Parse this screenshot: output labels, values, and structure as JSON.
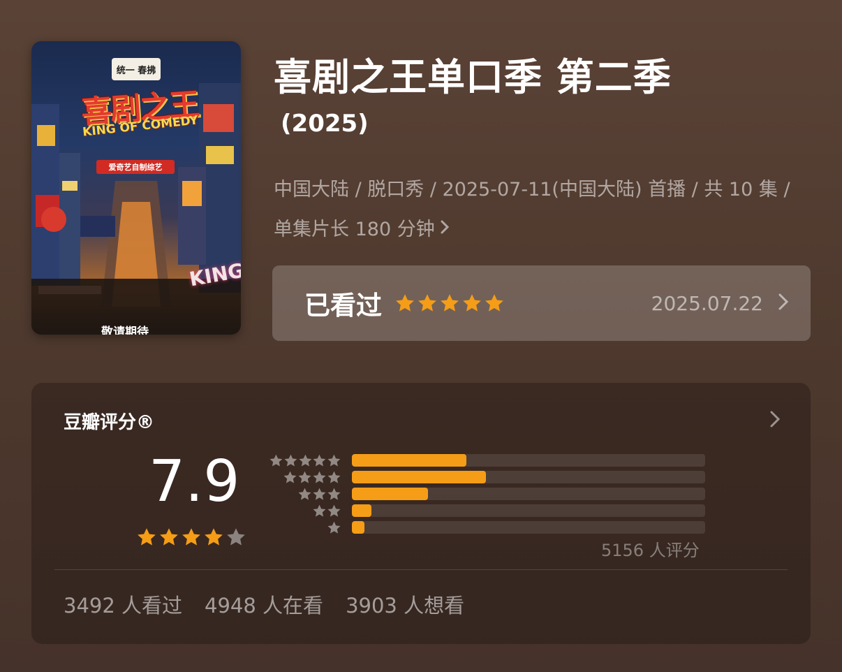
{
  "poster": {
    "badge": "统一 春拂",
    "title_cn": "喜剧之王",
    "title_en": "KING OF COMEDY",
    "subtitle": "爱奇艺自制综艺",
    "bottom_text": "敬请期待",
    "sign": "KING"
  },
  "header": {
    "title": "喜剧之王单口季 第二季",
    "year": "(2025)",
    "meta": "中国大陆 / 脱口秀 / 2025-07-11(中国大陆) 首播 / 共 10 集 / 单集片长 180 分钟"
  },
  "watched": {
    "label": "已看过",
    "stars": 5,
    "date": "2025.07.22"
  },
  "rating": {
    "title": "豆瓣评分®",
    "score": "7.9",
    "stars": 4,
    "distribution": [
      {
        "stars": 5,
        "fraction": 0.325
      },
      {
        "stars": 4,
        "fraction": 0.38
      },
      {
        "stars": 3,
        "fraction": 0.215
      },
      {
        "stars": 2,
        "fraction": 0.055
      },
      {
        "stars": 1,
        "fraction": 0.035
      }
    ],
    "count_text": "5156 人评分"
  },
  "stats": {
    "watched": "3492 人看过",
    "watching": "4948 人在看",
    "wish": "3903 人想看"
  },
  "colors": {
    "accent": "#f59d17",
    "star_empty": "#8a8380"
  }
}
